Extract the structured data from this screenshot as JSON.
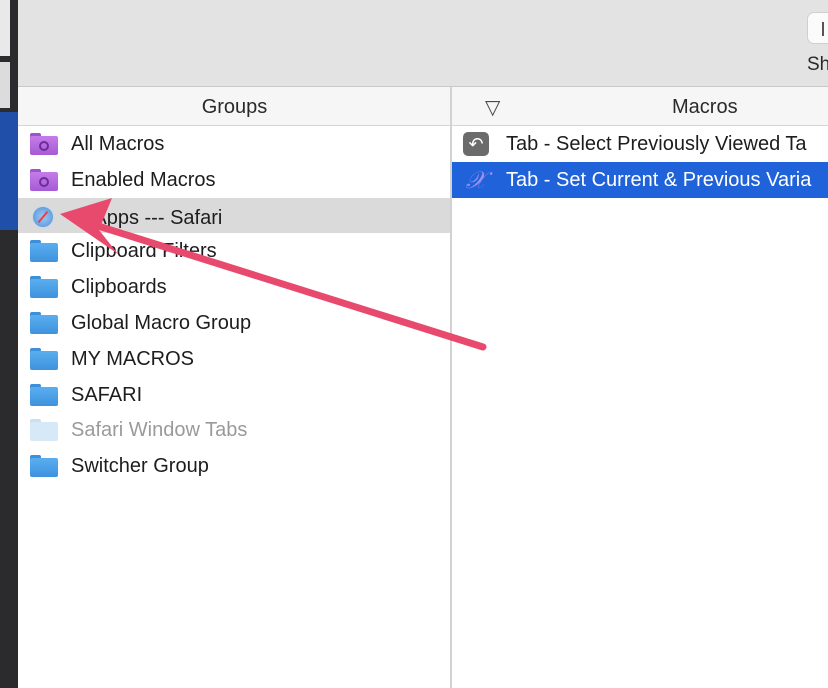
{
  "toolbar": {
    "button_label": "Sh"
  },
  "groups": {
    "header": "Groups",
    "items": [
      {
        "label": "All Macros",
        "icon": "smart-folder-icon"
      },
      {
        "label": "Enabled Macros",
        "icon": "smart-folder-icon"
      },
      {
        "label": "☀ Apps --- Safari",
        "icon": "safari-icon",
        "selected": true
      },
      {
        "label": "Clipboard Filters",
        "icon": "folder-icon"
      },
      {
        "label": "Clipboards",
        "icon": "folder-icon"
      },
      {
        "label": "Global Macro Group",
        "icon": "folder-icon"
      },
      {
        "label": "MY MACROS",
        "icon": "folder-icon"
      },
      {
        "label": "SAFARI",
        "icon": "folder-icon"
      },
      {
        "label": "Safari Window Tabs",
        "icon": "folder-icon",
        "disabled": true
      },
      {
        "label": "Switcher Group",
        "icon": "folder-icon"
      }
    ]
  },
  "macros": {
    "header": "Macros",
    "sort_indicator": "▽",
    "items": [
      {
        "label": "Tab - Select Previously Viewed Ta",
        "icon": "undo-icon"
      },
      {
        "label": "Tab - Set Current & Previous Varia",
        "icon": "variable-icon",
        "selected": true
      }
    ]
  },
  "colors": {
    "selection_blue": "#1f62d9",
    "arrow": "#e84a6e"
  }
}
